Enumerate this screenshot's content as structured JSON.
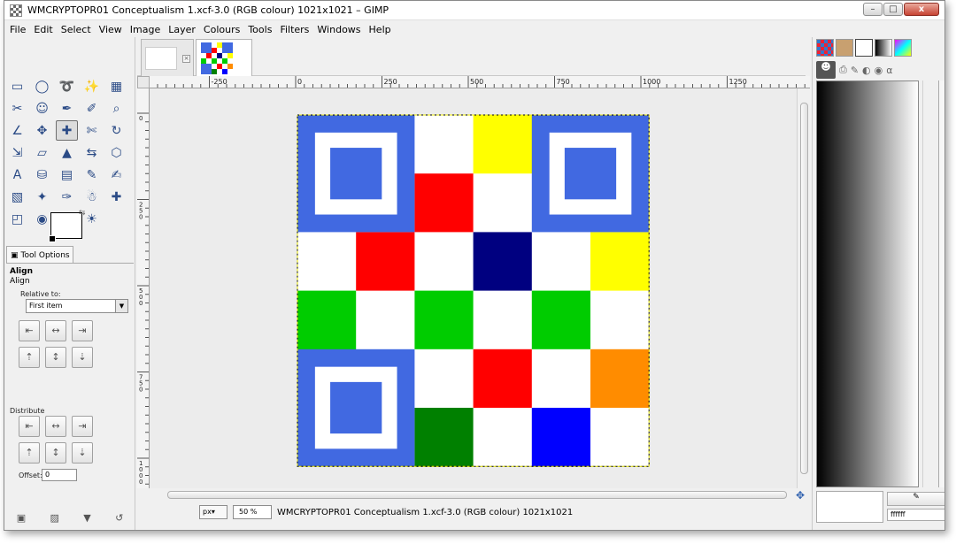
{
  "window": {
    "title": "WMCRYPTOPR01 Conceptualism 1.xcf-3.0 (RGB colour) 1021x1021 – GIMP",
    "controls": {
      "minimize": "–",
      "maximize": "□",
      "close": "x"
    }
  },
  "menubar": [
    "File",
    "Edit",
    "Select",
    "View",
    "Image",
    "Layer",
    "Colours",
    "Tools",
    "Filters",
    "Windows",
    "Help"
  ],
  "toolbox": {
    "tools": [
      {
        "icon": "rect-select-icon",
        "glyph": "▭"
      },
      {
        "icon": "ellipse-select-icon",
        "glyph": "◯"
      },
      {
        "icon": "free-select-icon",
        "glyph": "➰"
      },
      {
        "icon": "fuzzy-select-icon",
        "glyph": "✨"
      },
      {
        "icon": "color-select-icon",
        "glyph": "▦"
      },
      {
        "icon": "scissors-select-icon",
        "glyph": "✂"
      },
      {
        "icon": "foreground-select-icon",
        "glyph": "☺"
      },
      {
        "icon": "paths-icon",
        "glyph": "✒"
      },
      {
        "icon": "color-picker-icon",
        "glyph": "✐"
      },
      {
        "icon": "zoom-icon",
        "glyph": "⌕"
      },
      {
        "icon": "measure-icon",
        "glyph": "∠"
      },
      {
        "icon": "move-icon",
        "glyph": "✥"
      },
      {
        "icon": "align-icon",
        "glyph": "✚"
      },
      {
        "icon": "crop-icon",
        "glyph": "✄"
      },
      {
        "icon": "rotate-icon",
        "glyph": "↻"
      },
      {
        "icon": "scale-icon",
        "glyph": "⇲"
      },
      {
        "icon": "shear-icon",
        "glyph": "▱"
      },
      {
        "icon": "perspective-icon",
        "glyph": "▲"
      },
      {
        "icon": "flip-icon",
        "glyph": "⇆"
      },
      {
        "icon": "cage-transform-icon",
        "glyph": "⬡"
      },
      {
        "icon": "text-icon",
        "glyph": "A"
      },
      {
        "icon": "bucket-fill-icon",
        "glyph": "⛁"
      },
      {
        "icon": "blend-icon",
        "glyph": "▤"
      },
      {
        "icon": "pencil-icon",
        "glyph": "✎"
      },
      {
        "icon": "paintbrush-icon",
        "glyph": "✍"
      },
      {
        "icon": "eraser-icon",
        "glyph": "▧"
      },
      {
        "icon": "airbrush-icon",
        "glyph": "✦"
      },
      {
        "icon": "ink-icon",
        "glyph": "✑"
      },
      {
        "icon": "clone-icon",
        "glyph": "☃"
      },
      {
        "icon": "heal-icon",
        "glyph": "✚"
      },
      {
        "icon": "perspective-clone-icon",
        "glyph": "◰"
      },
      {
        "icon": "blur-icon",
        "glyph": "◉"
      },
      {
        "icon": "smudge-icon",
        "glyph": "☛"
      },
      {
        "icon": "dodge-burn-icon",
        "glyph": "☀"
      }
    ],
    "active_tool_index": 12,
    "bottom_icons": [
      {
        "name": "save-options-icon",
        "glyph": "▣"
      },
      {
        "name": "restore-options-icon",
        "glyph": "▨"
      },
      {
        "name": "delete-options-icon",
        "glyph": "▼"
      },
      {
        "name": "reset-options-icon",
        "glyph": "↺"
      }
    ]
  },
  "tool_options": {
    "tab_label": "Tool Options",
    "heading": "Align",
    "subheading": "Align",
    "relative_to_label": "Relative to:",
    "relative_to_value": "First item",
    "distribute_label": "Distribute",
    "offset_label": "Offset:",
    "offset_value": "0",
    "align_buttons": [
      "⇤",
      "↔",
      "⇥",
      "⇡",
      "↕",
      "⇣"
    ],
    "distribute_buttons": [
      "⇤",
      "↔",
      "⇥",
      "⇡",
      "↕",
      "⇣"
    ]
  },
  "image_tabs": [
    {
      "name": "blank image"
    },
    {
      "name": "Conceptualism 1"
    }
  ],
  "rulers": {
    "horizontal": [
      "-250",
      "0",
      "250",
      "500",
      "750",
      "1000",
      "1250"
    ],
    "vertical": [
      "0",
      "2 5 0",
      "5 0 0",
      "7 5 0",
      "1 0 0 0"
    ]
  },
  "canvas": {
    "colors": {
      "blue": "#4169E1",
      "white": "#FFFFFF",
      "yellow": "#FFFF00",
      "red": "#FF0000",
      "navy": "#000080",
      "green": "#00CC00",
      "darkgreen": "#008000",
      "orange": "#FF8C00",
      "pureblue": "#0000FF"
    },
    "grid": [
      [
        "F",
        "F",
        "white",
        "yellow",
        "F",
        "F"
      ],
      [
        "F",
        "F",
        "red",
        "white",
        "F",
        "F"
      ],
      [
        "white",
        "red",
        "white",
        "navy",
        "white",
        "yellow"
      ],
      [
        "green",
        "white",
        "green",
        "white",
        "green",
        "white"
      ],
      [
        "F",
        "F",
        "white",
        "red",
        "white",
        "orange"
      ],
      [
        "F",
        "F",
        "darkgreen",
        "white",
        "pureblue",
        "white"
      ]
    ]
  },
  "statusbar": {
    "unit": "px",
    "zoom": "50 %",
    "message": "WMCRYPTOPR01 Conceptualism 1.xcf-3.0 (RGB colour) 1021x1021"
  },
  "right_dock": {
    "hex_value": "ffffff"
  }
}
